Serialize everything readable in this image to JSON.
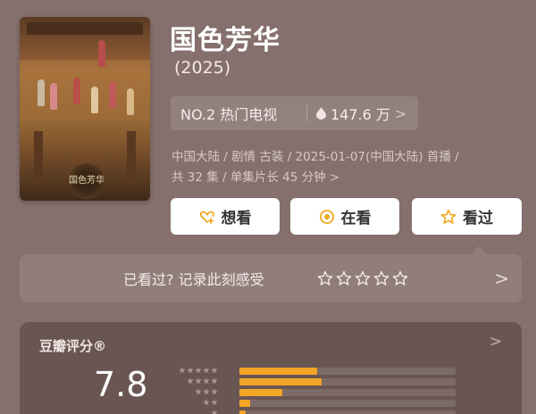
{
  "show": {
    "title": "国色芳华",
    "year": "(2025)",
    "rank": "NO.2 热门电视",
    "heat": "147.6 万",
    "heat_arrow": ">",
    "meta_line1": "中国大陆 / 剧情 古装 / 2025-01-07(中国大陆) 首播 /",
    "meta_line2": "共 32 集 / 单集片长 45 分钟 >",
    "poster_text": "国色芳华"
  },
  "actions": {
    "want": "想看",
    "watching": "在看",
    "watched": "看过"
  },
  "record": {
    "prompt": "已看过? 记录此刻感受",
    "arrow": ">"
  },
  "rating": {
    "label": "豆瓣评分®",
    "score": "7.8",
    "chevron": ">",
    "distribution": [
      {
        "stars": 5,
        "fraction": 0.36
      },
      {
        "stars": 4,
        "fraction": 0.38
      },
      {
        "stars": 3,
        "fraction": 0.2
      },
      {
        "stars": 2,
        "fraction": 0.05
      },
      {
        "stars": 1,
        "fraction": 0.03
      }
    ]
  },
  "colors": {
    "background": "#85706d",
    "bar": "#f3a526",
    "accent_icon": "#f0a81e"
  }
}
